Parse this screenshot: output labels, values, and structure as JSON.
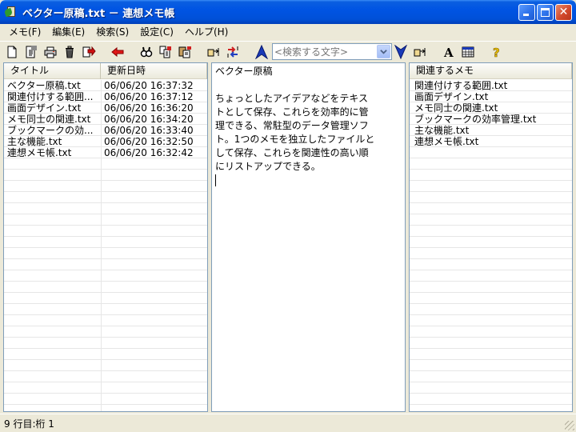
{
  "window": {
    "title": "ベクター原稿.txt － 連想メモ帳"
  },
  "menu": [
    "メモ(F)",
    "編集(E)",
    "検索(S)",
    "設定(C)",
    "ヘルプ(H)"
  ],
  "toolbar": {
    "search_placeholder": "<検索する文字>",
    "icons": [
      "new-file-icon",
      "open-file-icon",
      "print-icon",
      "trash-icon",
      "export-icon",
      "back-arrow-icon",
      "find-icon",
      "copy-icon",
      "paste-icon",
      "link-icon",
      "sort-icon",
      "search-up-icon",
      "search-down-icon",
      "jump-icon",
      "font-icon",
      "table-icon",
      "help-icon"
    ]
  },
  "list": {
    "headers": {
      "title": "タイトル",
      "date": "更新日時"
    },
    "rows": [
      {
        "title": "ベクター原稿.txt",
        "date": "06/06/20 16:37:32"
      },
      {
        "title": "関連付けする範囲...",
        "date": "06/06/20 16:37:12"
      },
      {
        "title": "画面デザイン.txt",
        "date": "06/06/20 16:36:20"
      },
      {
        "title": "メモ同士の関連.txt",
        "date": "06/06/20 16:34:20"
      },
      {
        "title": "ブックマークの効...",
        "date": "06/06/20 16:33:40"
      },
      {
        "title": "主な機能.txt",
        "date": "06/06/20 16:32:50"
      },
      {
        "title": "連想メモ帳.txt",
        "date": "06/06/20 16:32:42"
      }
    ]
  },
  "memo": {
    "lines": [
      "ベクター原稿",
      "",
      "ちょっとしたアイデアなどをテキス",
      "トとして保存、これらを効率的に管",
      "理できる、常駐型のデータ管理ソフ",
      "ト。1つのメモを独立したファイルと",
      "して保存、これらを関連性の高い順",
      "にリストアップできる。"
    ]
  },
  "related": {
    "header": "関連するメモ",
    "items": [
      "関連付けする範囲.txt",
      "画面デザイン.txt",
      "メモ同士の関連.txt",
      "ブックマークの効率管理.txt",
      "主な機能.txt",
      "連想メモ帳.txt"
    ]
  },
  "status": {
    "text": "9 行目:桁 1"
  }
}
